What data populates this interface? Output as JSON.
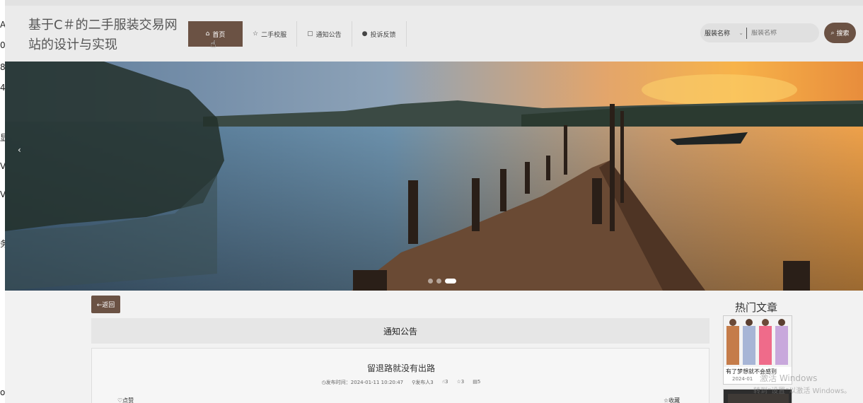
{
  "site": {
    "title": "基于C＃的二手服装交易网站的设计与实现"
  },
  "nav": {
    "items": [
      {
        "label": "首页",
        "icon": "home-icon",
        "active": true
      },
      {
        "label": "二手校服",
        "icon": "star-icon",
        "active": false
      },
      {
        "label": "通知公告",
        "icon": "bag-icon",
        "active": false
      },
      {
        "label": "投诉反馈",
        "icon": "info-icon",
        "active": false
      }
    ]
  },
  "search": {
    "field_label": "服装名称",
    "placeholder": "服装名称",
    "button_label": "搜索"
  },
  "banner": {
    "active_slide": 3,
    "slide_count": 3
  },
  "content": {
    "back_label": "←返回",
    "section_title": "通知公告",
    "article": {
      "title": "留退路就没有出路",
      "publish_time": "发布时间：2024-01-11 10:20:47",
      "publisher": "发布人3",
      "likes": "3",
      "stars": "3",
      "views": "5",
      "like_label": "点赞",
      "favorite_label": "收藏"
    }
  },
  "hot": {
    "title": "热门文章",
    "items": [
      {
        "caption": "有了梦想就不会感到",
        "date": "2024-01"
      }
    ]
  },
  "watermark": {
    "line1": "激活 Windows",
    "line2": "转到“设置”以激活 Windows。"
  },
  "leftstrip": [
    "A",
    "0",
    "8",
    "4",
    "显",
    "V",
    "V",
    "务",
    "ov"
  ]
}
